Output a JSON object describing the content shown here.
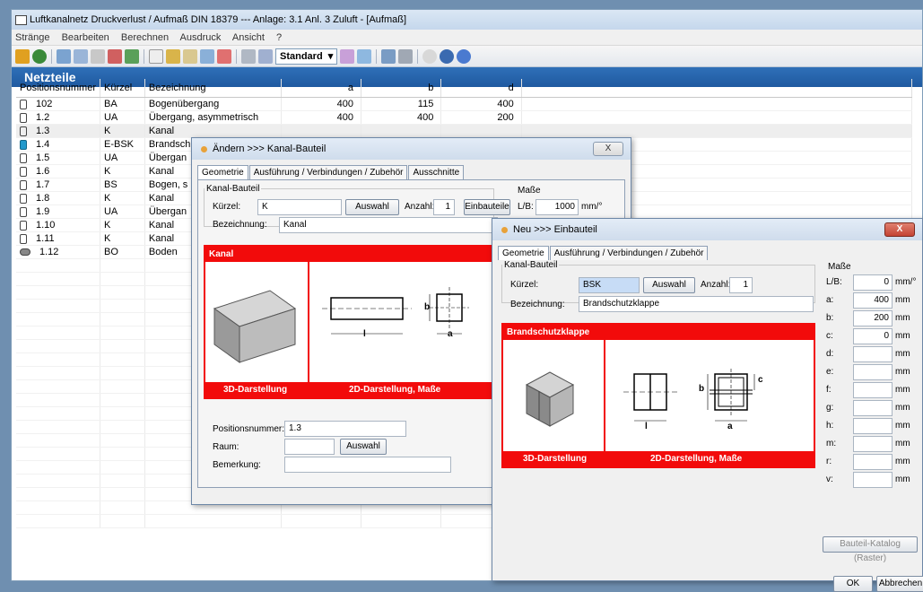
{
  "window": {
    "title": "Luftkanalnetz Druckverlust / Aufmaß DIN 18379 --- Anlage: 3.1 Anl. 3  Zuluft - [Aufmaß]"
  },
  "menu": [
    "Stränge",
    "Bearbeiten",
    "Berechnen",
    "Ausdruck",
    "Ansicht",
    "?"
  ],
  "toolbar": {
    "view_select": "Standard"
  },
  "section": {
    "title": "Netzteile"
  },
  "table": {
    "columns": [
      "Positionsnummer",
      "Kürzel",
      "Bezeichnung",
      "a",
      "b",
      "d"
    ],
    "rows": [
      {
        "pos": "102",
        "kuerzel": "BA",
        "bez": "Bogenübergang",
        "a": "400",
        "b": "115",
        "d": "400",
        "icon": "kanal-icon"
      },
      {
        "pos": "1.2",
        "kuerzel": "UA",
        "bez": "Übergang, asymmetrisch",
        "a": "400",
        "b": "400",
        "d": "200",
        "icon": "kanal-icon"
      },
      {
        "pos": "1.3",
        "kuerzel": "K",
        "bez": "Kanal",
        "a": "",
        "b": "",
        "d": "",
        "icon": "kanal-icon"
      },
      {
        "pos": "1.4",
        "kuerzel": "E-BSK",
        "bez": "Brandsch",
        "a": "",
        "b": "",
        "d": "",
        "icon": "brandschutz-icon"
      },
      {
        "pos": "1.5",
        "kuerzel": "UA",
        "bez": "Übergan",
        "a": "",
        "b": "",
        "d": "",
        "icon": "kanal-icon"
      },
      {
        "pos": "1.6",
        "kuerzel": "K",
        "bez": "Kanal",
        "a": "",
        "b": "",
        "d": "",
        "icon": "kanal-icon"
      },
      {
        "pos": "1.7",
        "kuerzel": "BS",
        "bez": "Bogen, s",
        "a": "",
        "b": "",
        "d": "",
        "icon": "kanal-icon"
      },
      {
        "pos": "1.8",
        "kuerzel": "K",
        "bez": "Kanal",
        "a": "",
        "b": "",
        "d": "",
        "icon": "kanal-icon"
      },
      {
        "pos": "1.9",
        "kuerzel": "UA",
        "bez": "Übergan",
        "a": "",
        "b": "",
        "d": "",
        "icon": "kanal-icon"
      },
      {
        "pos": "1.10",
        "kuerzel": "K",
        "bez": "Kanal",
        "a": "",
        "b": "",
        "d": "",
        "icon": "kanal-icon"
      },
      {
        "pos": "1.11",
        "kuerzel": "K",
        "bez": "Kanal",
        "a": "",
        "b": "",
        "d": "",
        "icon": "kanal-icon"
      },
      {
        "pos": "1.12",
        "kuerzel": "BO",
        "bez": "Boden",
        "a": "",
        "b": "",
        "d": "",
        "icon": "boden-icon"
      }
    ]
  },
  "dialog_edit": {
    "title": "Ändern >>> Kanal-Bauteil",
    "close": "X",
    "tabs": [
      "Geometrie",
      "Ausführung / Verbindungen / Zubehör",
      "Ausschnitte"
    ],
    "group_label": "Kanal-Bauteil",
    "kuerzel_label": "Kürzel:",
    "kuerzel_value": "K",
    "auswahl": "Auswahl",
    "anzahl_label": "Anzahl:",
    "anzahl_value": "1",
    "einbauteile": "Einbauteile",
    "bezeichnung_label": "Bezeichnung:",
    "bezeichnung_value": "Kanal",
    "masse_label": "Maße",
    "lb_label": "L/B:",
    "lb_value": "1000",
    "lb_unit": "mm/°",
    "panel_title": "Kanal",
    "caption_3d": "3D-Darstellung",
    "caption_2d": "2D-Darstellung, Maße",
    "dim_l": "l",
    "dim_b": "b",
    "dim_a": "a",
    "pos_label": "Positionsnummer:",
    "pos_value": "1.3",
    "raum_label": "Raum:",
    "raum_auswahl": "Auswahl",
    "bemerkung_label": "Bemerkung:"
  },
  "dialog_new": {
    "title": "Neu >>> Einbauteil",
    "close": "X",
    "tabs": [
      "Geometrie",
      "Ausführung / Verbindungen / Zubehör"
    ],
    "group_label": "Kanal-Bauteil",
    "kuerzel_label": "Kürzel:",
    "kuerzel_value": "BSK",
    "auswahl": "Auswahl",
    "anzahl_label": "Anzahl:",
    "anzahl_value": "1",
    "bezeichnung_label": "Bezeichnung:",
    "bezeichnung_value": "Brandschutzklappe",
    "panel_title": "Brandschutzklappe",
    "caption_3d": "3D-Darstellung",
    "caption_2d": "2D-Darstellung, Maße",
    "dim_l": "l",
    "dim_b": "b",
    "dim_a": "a",
    "dim_c": "c",
    "masse_label": "Maße",
    "masse": [
      {
        "label": "L/B:",
        "value": "0",
        "unit": "mm/°"
      },
      {
        "label": "a:",
        "value": "400",
        "unit": "mm"
      },
      {
        "label": "b:",
        "value": "200",
        "unit": "mm"
      },
      {
        "label": "c:",
        "value": "0",
        "unit": "mm"
      },
      {
        "label": "d:",
        "value": "",
        "unit": "mm"
      },
      {
        "label": "e:",
        "value": "",
        "unit": "mm"
      },
      {
        "label": "f:",
        "value": "",
        "unit": "mm"
      },
      {
        "label": "g:",
        "value": "",
        "unit": "mm"
      },
      {
        "label": "h:",
        "value": "",
        "unit": "mm"
      },
      {
        "label": "m:",
        "value": "",
        "unit": "mm"
      },
      {
        "label": "r:",
        "value": "",
        "unit": "mm"
      },
      {
        "label": "v:",
        "value": "",
        "unit": "mm"
      }
    ],
    "katalog": "Bauteil-Katalog (Raster)",
    "ok": "OK",
    "cancel": "Abbrechen"
  }
}
